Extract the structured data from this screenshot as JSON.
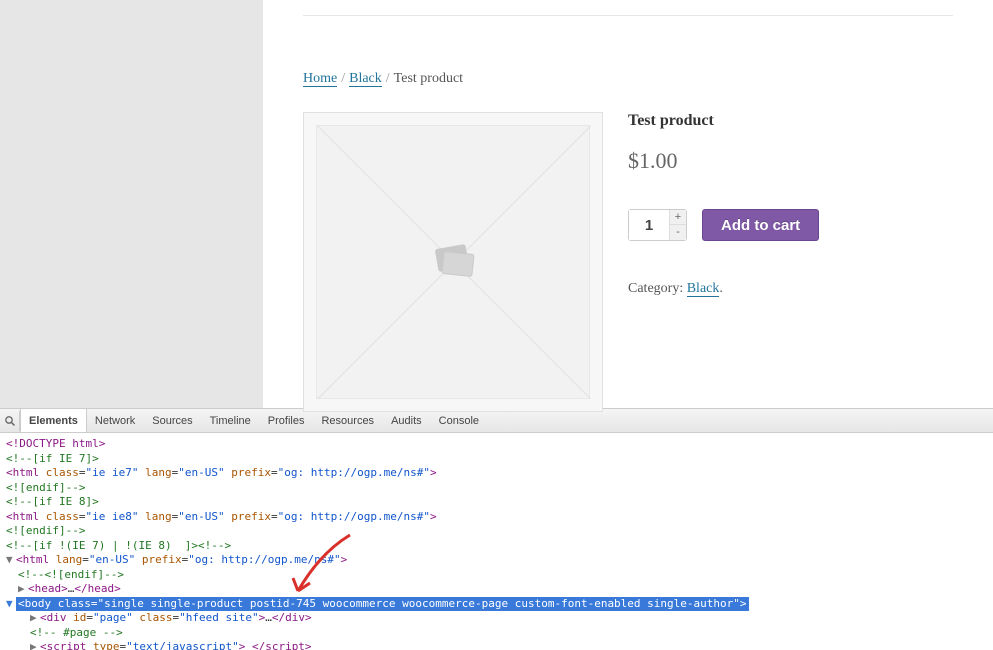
{
  "breadcrumb": [
    "Home",
    "Black",
    "Test product"
  ],
  "product": {
    "title": "Test product",
    "price": "$1.00",
    "quantity": "1",
    "qty_plus": "+",
    "qty_minus": "-",
    "add_to_cart": "Add to cart",
    "category_label": "Category:",
    "category_value": "Black"
  },
  "devtools": {
    "tabs": [
      "Elements",
      "Network",
      "Sources",
      "Timeline",
      "Profiles",
      "Resources",
      "Audits",
      "Console"
    ],
    "lang": "en-US",
    "prefix": "og: http://ogp.me/ns#",
    "ie7_class": "ie ie7",
    "ie8_class": "ie ie8",
    "body_class": "single single-product postid-745 woocommerce woocommerce-page custom-font-enabled single-author",
    "page_id": "page",
    "page_class": "hfeed site",
    "script_type": "text/javascript",
    "lines": {
      "0": "<!DOCTYPE html>",
      "1": "<!--[if IE 7]>",
      "3": "<![endif]-->",
      "4": "<!--[if IE 8]>",
      "6": "<![endif]-->",
      "7": "<!--[if !(IE 7) | !(IE 8)  ]><!-->",
      "9": "<!--<![endif]-->",
      "13": "<!-- #page -->"
    }
  }
}
